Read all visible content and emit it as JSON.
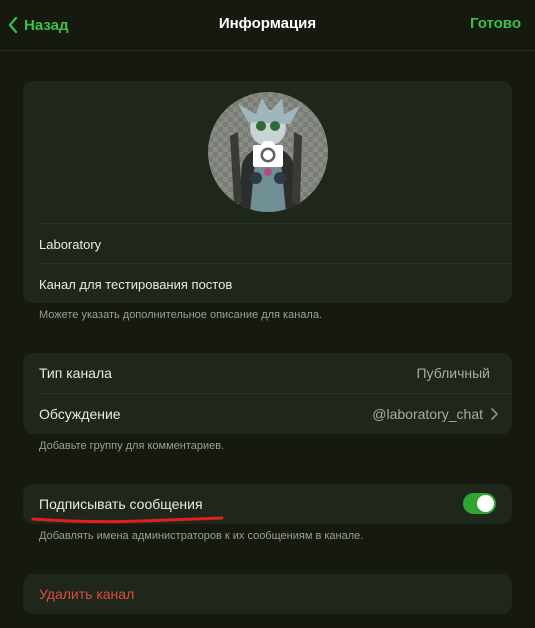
{
  "nav": {
    "back_label": "Назад",
    "title": "Информация",
    "done_label": "Готово"
  },
  "profile": {
    "name": "Laboratory",
    "description": "Канал для тестирования постов",
    "hint": "Можете указать дополнительное описание для канала."
  },
  "settings": {
    "type_label": "Тип канала",
    "type_value": "Публичный",
    "discussion_label": "Обсуждение",
    "discussion_value": "@laboratory_chat",
    "hint": "Добавьте группу для комментариев."
  },
  "signatures": {
    "label": "Подписывать сообщения",
    "enabled": true,
    "hint": "Добавлять имена администраторов к их сообщениям в канале."
  },
  "delete": {
    "label": "Удалить канал"
  },
  "colors": {
    "accent": "#3fbf4a",
    "danger": "#e04b43",
    "annotation": "#e0201b"
  },
  "icons": {
    "back": "chevron-left-icon",
    "camera": "camera-icon",
    "chevron": "chevron-right-icon"
  }
}
